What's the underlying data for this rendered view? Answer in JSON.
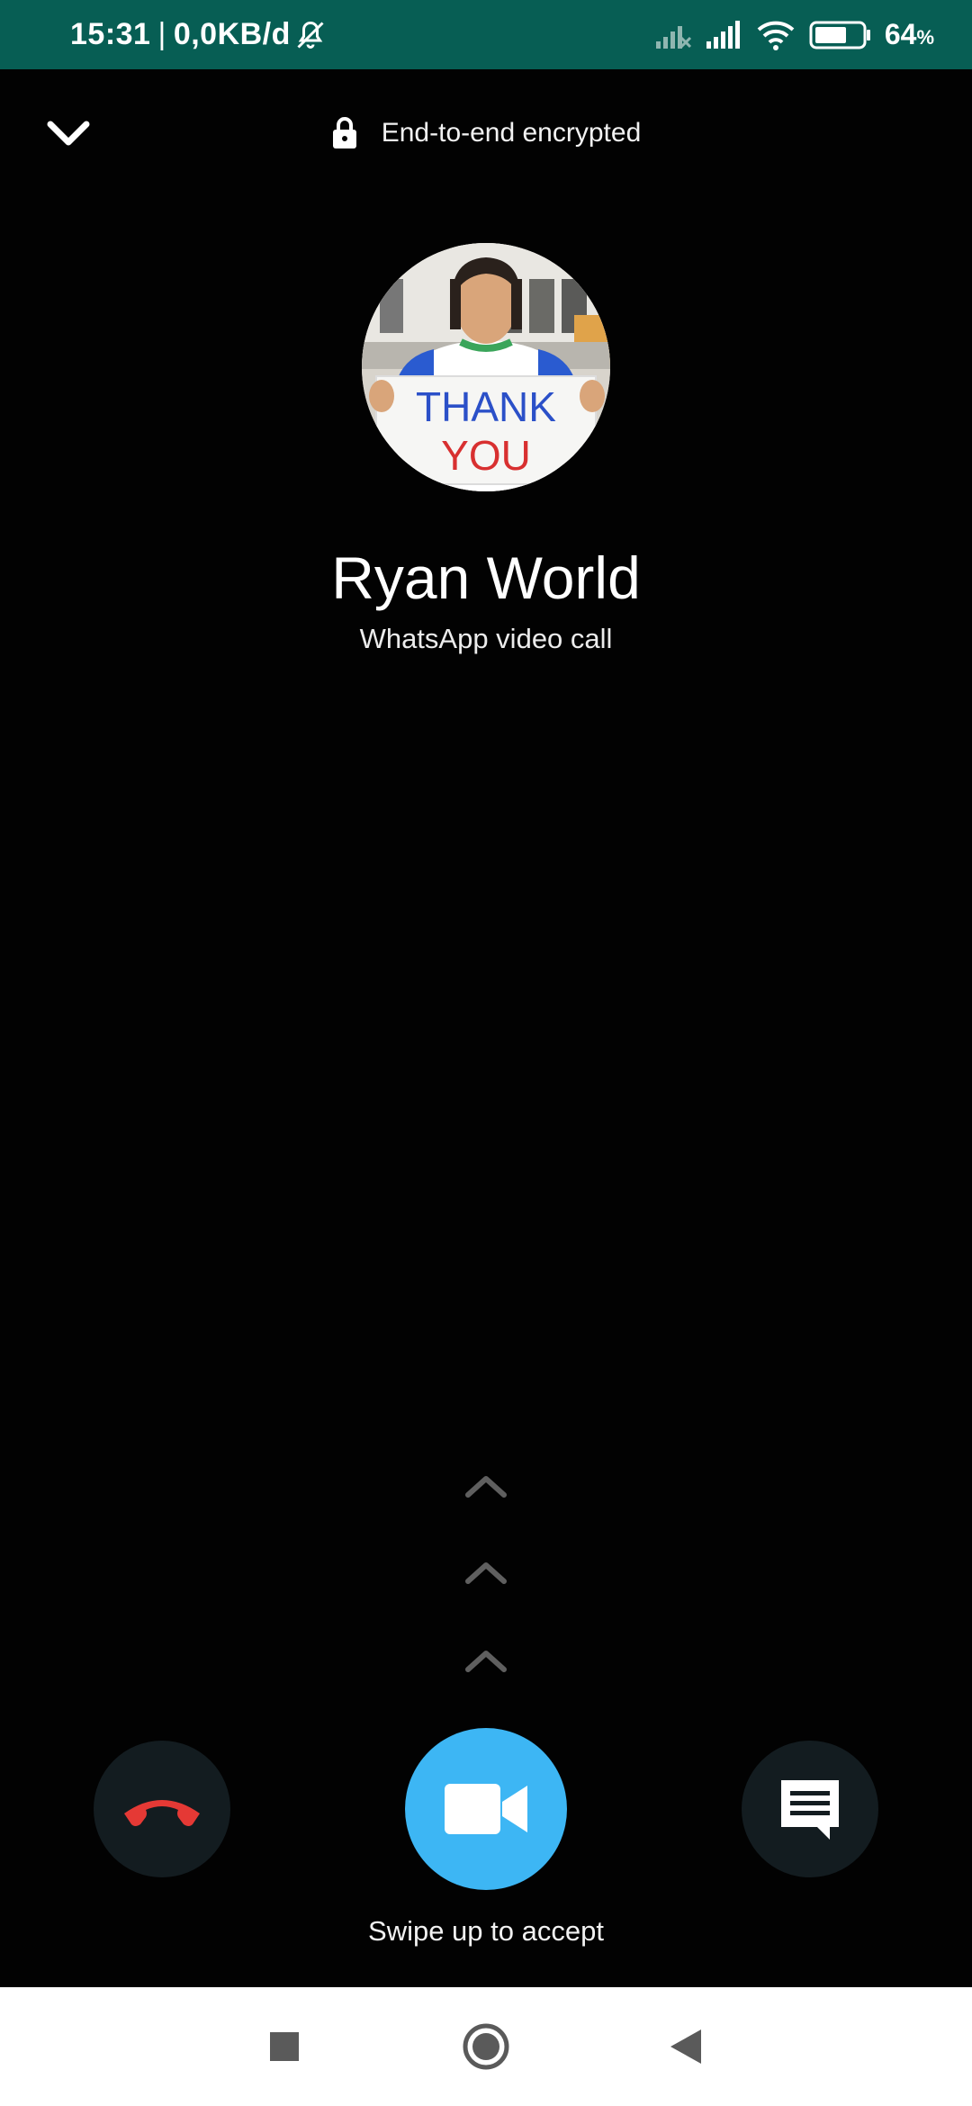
{
  "status_bar": {
    "time": "15:31",
    "separator": "|",
    "data_rate": "0,0KB/d",
    "battery_level": "64",
    "battery_unit": "%",
    "icons": [
      "notifications-muted-icon",
      "signal-weak-icon",
      "signal-strong-icon",
      "wifi-icon",
      "battery-icon"
    ],
    "bg_color": "#075E54"
  },
  "call": {
    "encryption_label": "End-to-end encrypted",
    "caller_name": "Ryan World",
    "call_type": "WhatsApp video call",
    "avatar_sign_line1": "THANK",
    "avatar_sign_line2": "YOU",
    "swipe_hint": "Swipe up to accept"
  },
  "buttons": {
    "collapse": "chevron-down-icon",
    "decline": "phone-hangup-icon",
    "accept": "video-camera-icon",
    "message": "message-icon"
  },
  "colors": {
    "accept": "#3db6f4",
    "decline_icon": "#e53935",
    "secondary_btn_bg": "#131c20"
  },
  "nav_bar": {
    "items": [
      "recents-square-icon",
      "home-circle-icon",
      "back-triangle-icon"
    ]
  }
}
